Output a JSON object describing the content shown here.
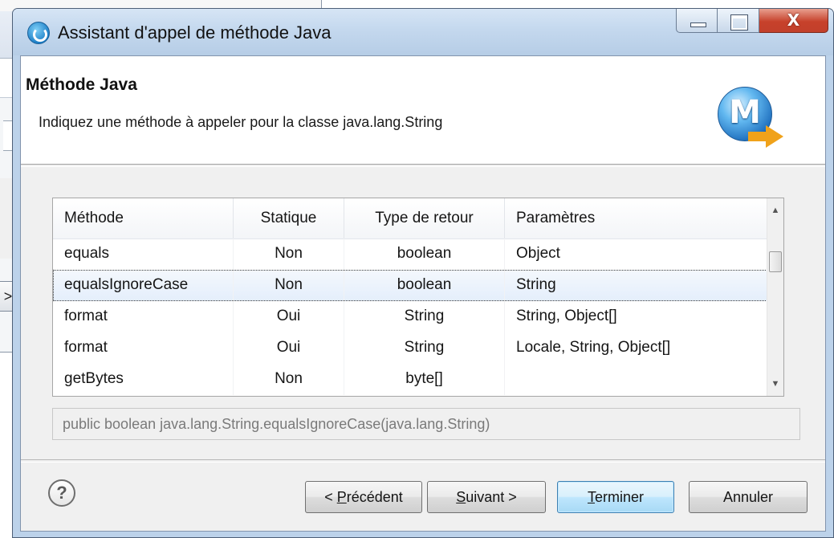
{
  "window": {
    "title": "Assistant d'appel de méthode Java",
    "close_symbol": "X"
  },
  "header": {
    "title": "Méthode Java",
    "description": "Indiquez une méthode à appeler pour la classe java.lang.String",
    "logo_letter": "M"
  },
  "background_window": {
    "button_glyph": ">"
  },
  "table": {
    "columns": [
      "Méthode",
      "Statique",
      "Type de retour",
      "Paramètres"
    ],
    "rows": [
      {
        "method": "equals",
        "static": "Non",
        "return_type": "boolean",
        "params": "Object",
        "selected": false
      },
      {
        "method": "equalsIgnoreCase",
        "static": "Non",
        "return_type": "boolean",
        "params": "String",
        "selected": true
      },
      {
        "method": "format",
        "static": "Oui",
        "return_type": "String",
        "params": "String, Object[]",
        "selected": false
      },
      {
        "method": "format",
        "static": "Oui",
        "return_type": "String",
        "params": "Locale, String, Object[]",
        "selected": false
      },
      {
        "method": "getBytes",
        "static": "Non",
        "return_type": "byte[]",
        "params": "",
        "selected": false
      }
    ]
  },
  "signature": "public boolean java.lang.String.equalsIgnoreCase(java.lang.String)",
  "buttons": {
    "help": "?",
    "previous": {
      "prefix": "< ",
      "mnemonic": "P",
      "rest": "récédent"
    },
    "next": {
      "mnemonic": "S",
      "rest": "uivant >"
    },
    "finish": {
      "mnemonic": "T",
      "rest": "erminer"
    },
    "cancel": "Annuler"
  },
  "colors": {
    "title_bar": "#c4d8ee",
    "close_button": "#c7412b",
    "default_button_border": "#3c7fb1"
  }
}
